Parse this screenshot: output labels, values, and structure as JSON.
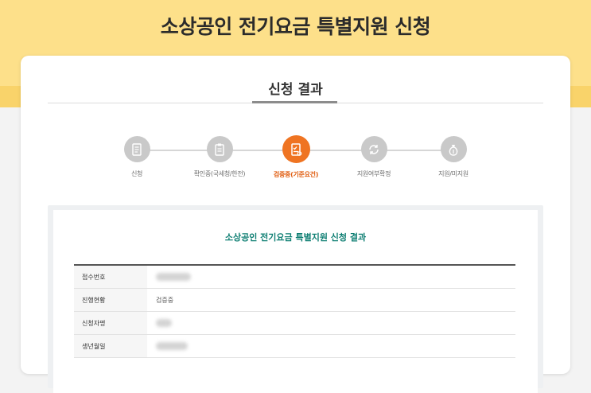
{
  "header": {
    "title": "소상공인 전기요금 특별지원 신청"
  },
  "section": {
    "title": "신청 결과"
  },
  "steps": [
    {
      "label": "신청",
      "icon": "document-icon",
      "active": false
    },
    {
      "label": "확인중(국세청/한전)",
      "icon": "clipboard-icon",
      "active": false
    },
    {
      "label": "검증중(기준요건)",
      "icon": "checklist-icon",
      "active": true
    },
    {
      "label": "지원여부확정",
      "icon": "refresh-icon",
      "active": false
    },
    {
      "label": "지원/미지원",
      "icon": "money-bag-icon",
      "active": false
    }
  ],
  "result": {
    "title": "소상공인 전기요금 특별지원 신청 결과",
    "rows": [
      {
        "label": "접수번호",
        "value": ""
      },
      {
        "label": "진행현황",
        "value": "검증중"
      },
      {
        "label": "신청자명",
        "value": ""
      },
      {
        "label": "생년월일",
        "value": ""
      }
    ]
  },
  "colors": {
    "band": "#fde08a",
    "active_step": "#ef7422",
    "result_title": "#0f7f73"
  }
}
